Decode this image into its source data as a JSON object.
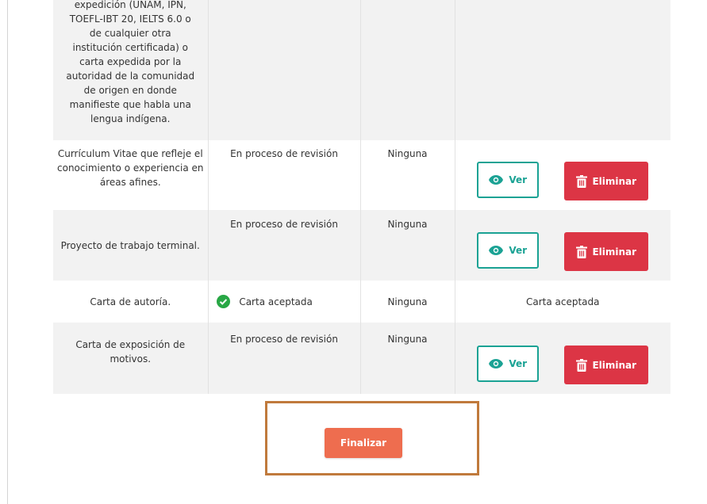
{
  "colors": {
    "teal": "#1aa294",
    "danger": "#dc3545",
    "finish": "#ee6d4f",
    "highlight_border": "#c07a3c",
    "success": "#28a745"
  },
  "rows": [
    {
      "document": "expedición (UNAM, IPN, TOEFL-IBT 20, IELTS 6.0 o de cualquier otra institución certificada) o carta expedida por la autoridad de la comunidad de origen en donde manifieste que habla una lengua indígena.",
      "status": "",
      "observations": "",
      "action_text": ""
    },
    {
      "document": "Currículum Vitae que refleje el conocimiento o experiencia en áreas afines.",
      "status": "En proceso de revisión",
      "observations": "Ninguna",
      "view_label": "Ver",
      "delete_label": "Eliminar"
    },
    {
      "document": "Proyecto de trabajo terminal.",
      "status": "En proceso de revisión",
      "observations": "Ninguna",
      "view_label": "Ver",
      "delete_label": "Eliminar"
    },
    {
      "document": "Carta de autoría.",
      "status": "Carta aceptada",
      "status_icon": "check-circle-icon",
      "observations": "Ninguna",
      "action_text": "Carta aceptada"
    },
    {
      "document": "Carta de exposición de motivos.",
      "status": "En proceso de revisión",
      "observations": "Ninguna",
      "view_label": "Ver",
      "delete_label": "Eliminar"
    }
  ],
  "finish_label": "Finalizar"
}
